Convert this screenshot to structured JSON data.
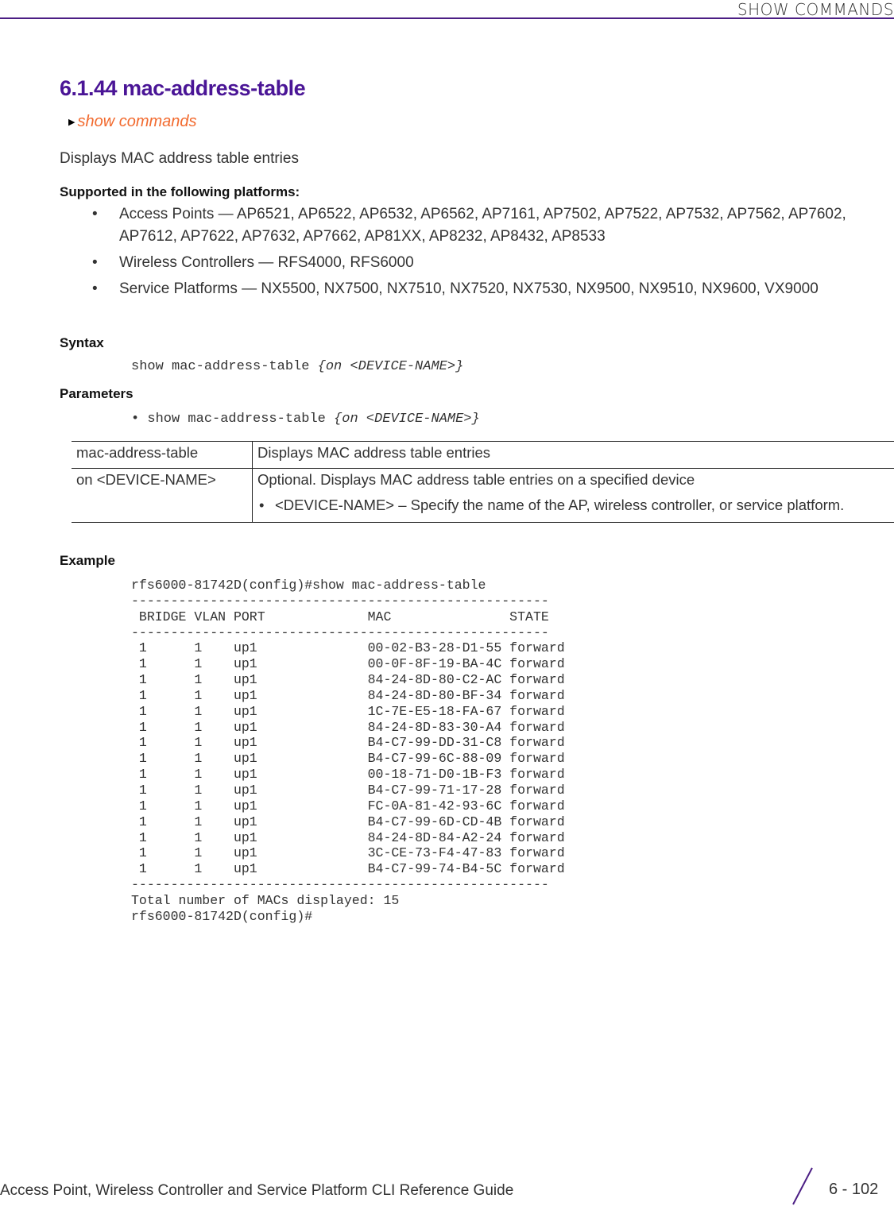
{
  "header": {
    "section": "SHOW COMMANDS"
  },
  "title": "6.1.44 mac-address-table",
  "breadcrumb": {
    "link": "show commands"
  },
  "description": "Displays MAC address table entries",
  "platforms": {
    "heading": "Supported in the following platforms:",
    "items": [
      "Access Points — AP6521, AP6522, AP6532, AP6562, AP7161, AP7502, AP7522, AP7532, AP7562, AP7602, AP7612, AP7622, AP7632, AP7662, AP81XX, AP8232, AP8432, AP8533",
      "Wireless Controllers — RFS4000, RFS6000",
      "Service Platforms — NX5500, NX7500, NX7510, NX7520, NX7530, NX9500, NX9510, NX9600, VX9000"
    ]
  },
  "syntax": {
    "heading": "Syntax",
    "command": "show mac-address-table ",
    "args": "{on <DEVICE-NAME>}"
  },
  "parameters": {
    "heading": "Parameters",
    "bullet": "•",
    "command": "show mac-address-table ",
    "args": "{on <DEVICE-NAME>}",
    "rows": [
      {
        "param": "mac-address-table",
        "desc": "Displays MAC address table entries",
        "sub": ""
      },
      {
        "param": "on <DEVICE-NAME>",
        "desc": "Optional. Displays MAC address table entries on a specified device",
        "sub": "<DEVICE-NAME> – Specify the name of the AP, wireless controller, or service platform."
      }
    ]
  },
  "example": {
    "heading": "Example",
    "prompt": "rfs6000-81742D(config)#show mac-address-table",
    "separator": "-----------------------------------------------------",
    "columns": [
      "BRIDGE",
      "VLAN",
      "PORT",
      "MAC",
      "STATE"
    ],
    "rows": [
      [
        "1",
        "1",
        "up1",
        "00-02-B3-28-D1-55",
        "forward"
      ],
      [
        "1",
        "1",
        "up1",
        "00-0F-8F-19-BA-4C",
        "forward"
      ],
      [
        "1",
        "1",
        "up1",
        "84-24-8D-80-C2-AC",
        "forward"
      ],
      [
        "1",
        "1",
        "up1",
        "84-24-8D-80-BF-34",
        "forward"
      ],
      [
        "1",
        "1",
        "up1",
        "1C-7E-E5-18-FA-67",
        "forward"
      ],
      [
        "1",
        "1",
        "up1",
        "84-24-8D-83-30-A4",
        "forward"
      ],
      [
        "1",
        "1",
        "up1",
        "B4-C7-99-DD-31-C8",
        "forward"
      ],
      [
        "1",
        "1",
        "up1",
        "B4-C7-99-6C-88-09",
        "forward"
      ],
      [
        "1",
        "1",
        "up1",
        "00-18-71-D0-1B-F3",
        "forward"
      ],
      [
        "1",
        "1",
        "up1",
        "B4-C7-99-71-17-28",
        "forward"
      ],
      [
        "1",
        "1",
        "up1",
        "FC-0A-81-42-93-6C",
        "forward"
      ],
      [
        "1",
        "1",
        "up1",
        "B4-C7-99-6D-CD-4B",
        "forward"
      ],
      [
        "1",
        "1",
        "up1",
        "84-24-8D-84-A2-24",
        "forward"
      ],
      [
        "1",
        "1",
        "up1",
        "3C-CE-73-F4-47-83",
        "forward"
      ],
      [
        "1",
        "1",
        "up1",
        "B4-C7-99-74-B4-5C",
        "forward"
      ]
    ],
    "total": "Total number of MACs displayed: 15",
    "end_prompt": "rfs6000-81742D(config)#"
  },
  "footer": {
    "guide_title": "Access Point, Wireless Controller and Service Platform CLI Reference Guide",
    "page_number": "6 - 102"
  },
  "colors": {
    "accent": "#4a1596",
    "link": "#f26a2e",
    "rule": "#4b1e84"
  }
}
